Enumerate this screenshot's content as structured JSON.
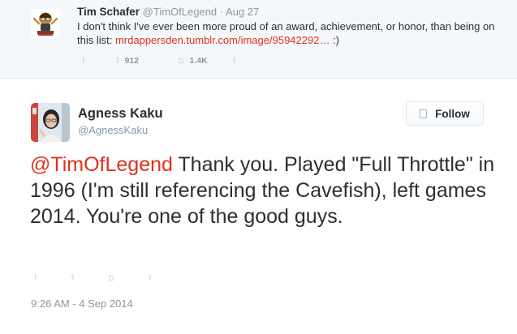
{
  "parent_tweet": {
    "name": "Tim Schafer",
    "handle": "@TimOfLegend",
    "separator": "·",
    "date": "Aug 27",
    "text_before_link": "I don't think I've ever been more proud of an award, achievement, or honor, than being on this list: ",
    "link": "mrdappersden.tumblr.com/image/95942292…",
    "text_after_link": " :)",
    "actions": {
      "reply_icon": "reply-icon",
      "retweet_icon": "retweet-icon",
      "retweet_count": "912",
      "favorite_icon": "favorite-icon",
      "favorite_count": "1.4K",
      "more_icon": "more-icon"
    }
  },
  "main_tweet": {
    "name": "Agness Kaku",
    "handle": "@AgnessKaku",
    "follow_label": "Follow",
    "mention": "@TimOfLegend",
    "text": " Thank you. Played \"Full Throttle\" in 1996 (I'm still referencing the Cavefish), left games 2014. You're one of the good guys.",
    "timestamp": "9:26 AM - 4 Sep 2014",
    "actions": [
      "reply-icon",
      "retweet-icon",
      "favorite-icon",
      "more-icon"
    ]
  },
  "colors": {
    "link": "#e0301e",
    "text": "#292f33",
    "muted": "#8899a6",
    "parent_background": "#f5f8fa"
  }
}
